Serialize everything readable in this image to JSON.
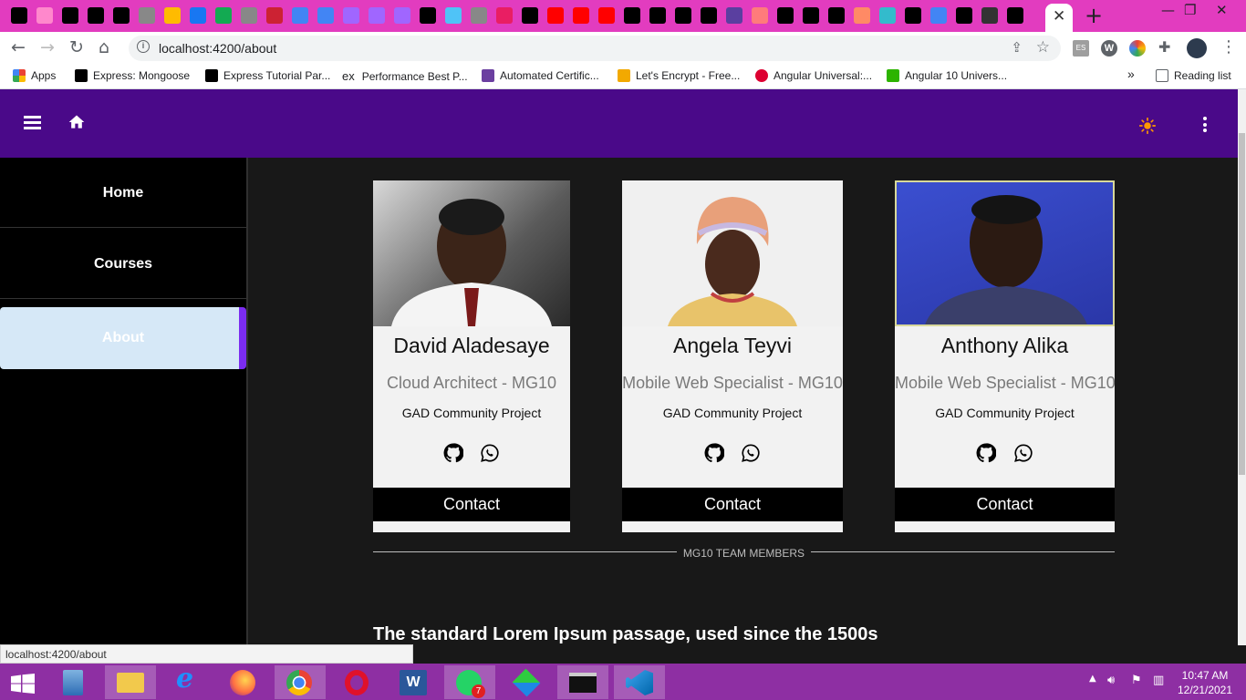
{
  "browser": {
    "url": "localhost:4200/about",
    "status_url": "localhost:4200/about",
    "tab_close": "✕",
    "new_tab": "+",
    "window_controls": [
      "—",
      "❐",
      "✕"
    ],
    "tab_favicon_colors": [
      "#000",
      "#f8c",
      "#000",
      "#000",
      "#000",
      "#888",
      "#fb0",
      "#1877f2",
      "#13aa52",
      "#888",
      "#c23",
      "#4285f4",
      "#4285f4",
      "#a066ff",
      "#a066ff",
      "#a066ff",
      "#000",
      "#4fc3f7",
      "#888",
      "#e91e63",
      "#000",
      "#ff0000",
      "#ff0000",
      "#ff0000",
      "#000",
      "#000",
      "#000",
      "#000",
      "#5a3fa0",
      "#ff7b7b",
      "#000",
      "#000",
      "#000",
      "#ff8a65",
      "#3bc",
      "#000",
      "#4285f4",
      "#000",
      "#333",
      "#000"
    ],
    "extensions": [
      "ES",
      "W",
      "color-picker",
      "puzzle",
      "profile"
    ]
  },
  "bookmarks": {
    "apps_label": "Apps",
    "items": [
      {
        "label": "Express: Mongoose",
        "color": "#000"
      },
      {
        "label": "Express Tutorial Par...",
        "color": "#000"
      },
      {
        "label": "Performance Best P...",
        "color": "#fff",
        "glyph": "ex"
      },
      {
        "label": "Automated Certific...",
        "color": "#6b3fa0"
      },
      {
        "label": "Let's Encrypt - Free...",
        "color": "#f2a900"
      },
      {
        "label": "Angular Universal:...",
        "color": "#dd0031"
      },
      {
        "label": "Angular 10 Univers...",
        "color": "#2db400"
      }
    ],
    "overflow": "»",
    "reading_list": "Reading list"
  },
  "app": {
    "nav": [
      {
        "label": "Home",
        "active": false
      },
      {
        "label": "Courses",
        "active": false
      },
      {
        "label": "About",
        "active": true
      }
    ],
    "members": [
      {
        "name": "David Aladesaye",
        "role": "Cloud Architect - MG10",
        "project": "GAD Community Project",
        "contact": "Contact"
      },
      {
        "name": "Angela Teyvi",
        "role": "Mobile Web Specialist - MG10",
        "project": "GAD Community Project",
        "contact": "Contact"
      },
      {
        "name": "Anthony Alika",
        "role": "Mobile Web Specialist - MG10",
        "project": "GAD Community Project",
        "contact": "Contact"
      }
    ],
    "divider_label": "MG10 TEAM MEMBERS",
    "section_title": "The standard Lorem Ipsum passage, used since the 1500s"
  },
  "taskbar": {
    "apps": [
      "calculator",
      "file-explorer",
      "internet-explorer",
      "firefox",
      "chrome",
      "opera",
      "word",
      "whatsapp",
      "app-icon",
      "cmd",
      "vscode"
    ],
    "whatsapp_badge": "7",
    "time": "10:47 AM",
    "date": "12/21/2021"
  }
}
